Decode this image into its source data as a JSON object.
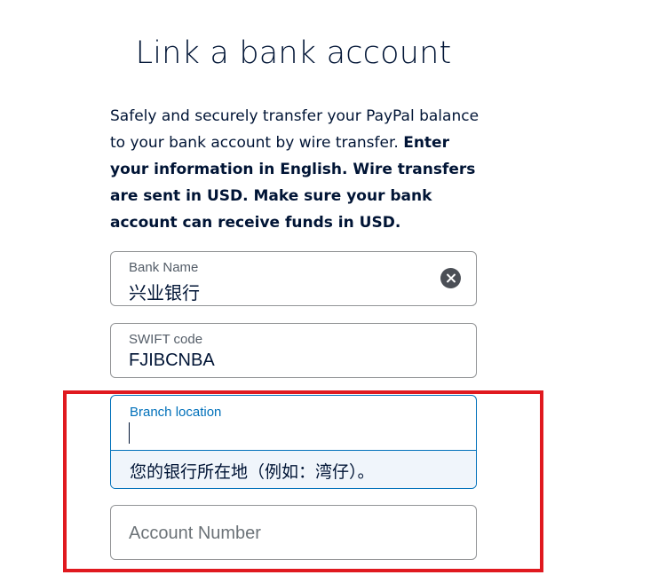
{
  "page": {
    "title": "Link a bank account",
    "intro_plain": "Safely and securely transfer your PayPal balance to your bank account by wire transfer. ",
    "intro_bold": "Enter your information in English. Wire transfers are sent in USD. Make sure your bank account can receive funds in USD."
  },
  "form": {
    "bank_name": {
      "label": "Bank Name",
      "value": "兴业银行"
    },
    "swift_code": {
      "label": "SWIFT code",
      "value": "FJIBCNBA"
    },
    "branch_location": {
      "label": "Branch location",
      "value": "",
      "helper": "您的银行所在地（例如：湾仔）。"
    },
    "account_number": {
      "placeholder": "Account Number",
      "value": ""
    }
  },
  "colors": {
    "text": "#001435",
    "focus": "#0070ba",
    "border": "#929496",
    "helper_bg": "#f0f5fb",
    "annotation": "#e0191f"
  },
  "icons": {
    "clear": "clear-circle-x-icon"
  }
}
